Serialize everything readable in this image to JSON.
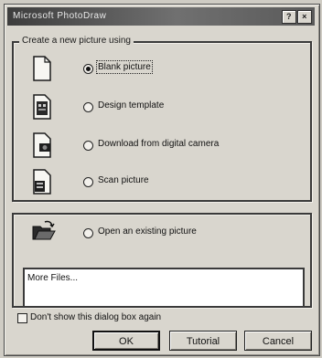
{
  "window": {
    "title": "Microsoft PhotoDraw"
  },
  "titlebar_buttons": {
    "help_label": "?",
    "close_label": "×"
  },
  "create_group": {
    "label": "Create a new picture using",
    "options": [
      {
        "label": "Blank picture",
        "icon": "blank-page-icon",
        "selected": true
      },
      {
        "label": "Design template",
        "icon": "design-template-icon",
        "selected": false
      },
      {
        "label": "Download from digital camera",
        "icon": "camera-page-icon",
        "selected": false
      },
      {
        "label": "Scan picture",
        "icon": "scan-page-icon",
        "selected": false
      }
    ]
  },
  "open_group": {
    "option_label": "Open an existing picture",
    "icon": "open-folder-icon",
    "file_list": [
      "More Files..."
    ]
  },
  "dont_show": {
    "label": "Don't show this dialog box again",
    "checked": false
  },
  "buttons": {
    "ok": "OK",
    "tutorial": "Tutorial",
    "cancel": "Cancel"
  }
}
